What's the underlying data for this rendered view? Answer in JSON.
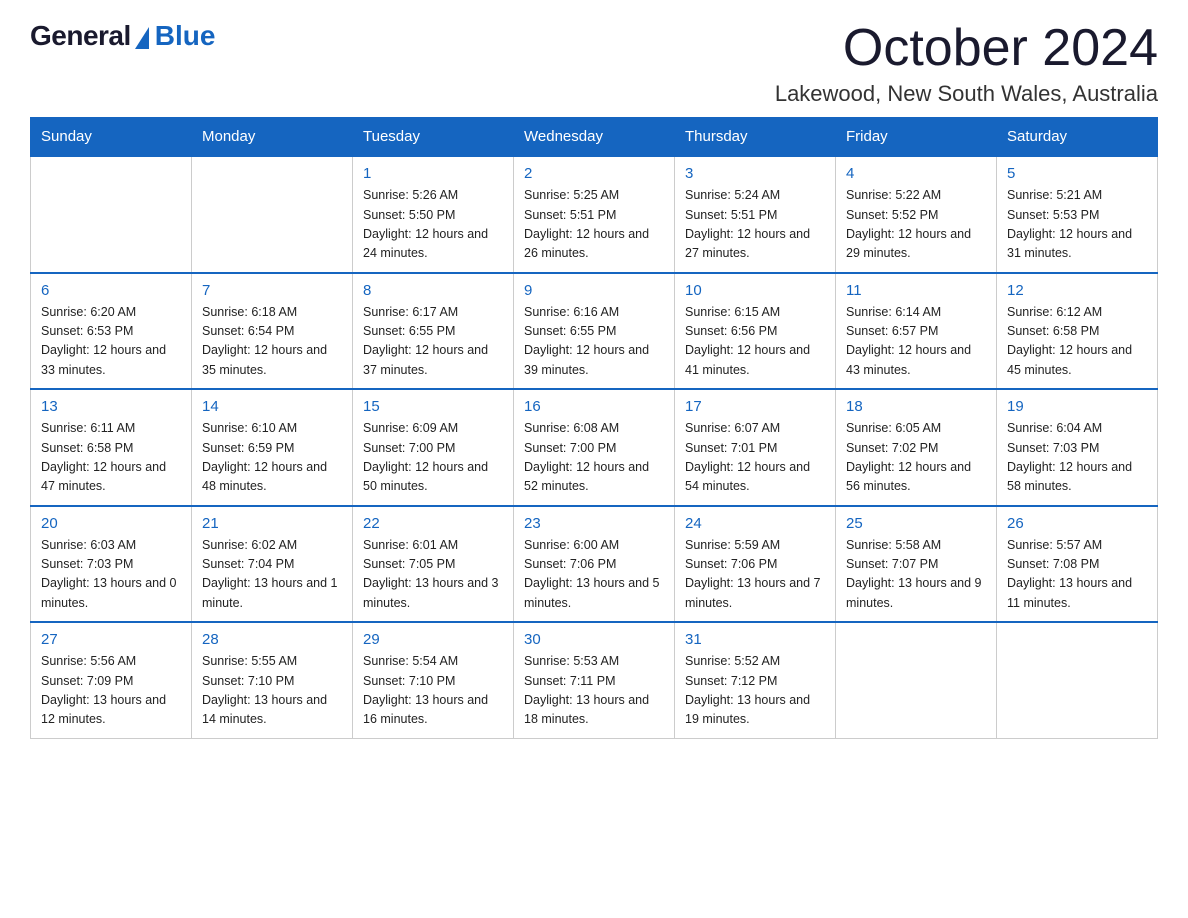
{
  "header": {
    "logo_general": "General",
    "logo_blue": "Blue",
    "month_title": "October 2024",
    "location": "Lakewood, New South Wales, Australia"
  },
  "days_of_week": [
    "Sunday",
    "Monday",
    "Tuesday",
    "Wednesday",
    "Thursday",
    "Friday",
    "Saturday"
  ],
  "weeks": [
    [
      {
        "day": "",
        "info": ""
      },
      {
        "day": "",
        "info": ""
      },
      {
        "day": "1",
        "info": "Sunrise: 5:26 AM\nSunset: 5:50 PM\nDaylight: 12 hours\nand 24 minutes."
      },
      {
        "day": "2",
        "info": "Sunrise: 5:25 AM\nSunset: 5:51 PM\nDaylight: 12 hours\nand 26 minutes."
      },
      {
        "day": "3",
        "info": "Sunrise: 5:24 AM\nSunset: 5:51 PM\nDaylight: 12 hours\nand 27 minutes."
      },
      {
        "day": "4",
        "info": "Sunrise: 5:22 AM\nSunset: 5:52 PM\nDaylight: 12 hours\nand 29 minutes."
      },
      {
        "day": "5",
        "info": "Sunrise: 5:21 AM\nSunset: 5:53 PM\nDaylight: 12 hours\nand 31 minutes."
      }
    ],
    [
      {
        "day": "6",
        "info": "Sunrise: 6:20 AM\nSunset: 6:53 PM\nDaylight: 12 hours\nand 33 minutes."
      },
      {
        "day": "7",
        "info": "Sunrise: 6:18 AM\nSunset: 6:54 PM\nDaylight: 12 hours\nand 35 minutes."
      },
      {
        "day": "8",
        "info": "Sunrise: 6:17 AM\nSunset: 6:55 PM\nDaylight: 12 hours\nand 37 minutes."
      },
      {
        "day": "9",
        "info": "Sunrise: 6:16 AM\nSunset: 6:55 PM\nDaylight: 12 hours\nand 39 minutes."
      },
      {
        "day": "10",
        "info": "Sunrise: 6:15 AM\nSunset: 6:56 PM\nDaylight: 12 hours\nand 41 minutes."
      },
      {
        "day": "11",
        "info": "Sunrise: 6:14 AM\nSunset: 6:57 PM\nDaylight: 12 hours\nand 43 minutes."
      },
      {
        "day": "12",
        "info": "Sunrise: 6:12 AM\nSunset: 6:58 PM\nDaylight: 12 hours\nand 45 minutes."
      }
    ],
    [
      {
        "day": "13",
        "info": "Sunrise: 6:11 AM\nSunset: 6:58 PM\nDaylight: 12 hours\nand 47 minutes."
      },
      {
        "day": "14",
        "info": "Sunrise: 6:10 AM\nSunset: 6:59 PM\nDaylight: 12 hours\nand 48 minutes."
      },
      {
        "day": "15",
        "info": "Sunrise: 6:09 AM\nSunset: 7:00 PM\nDaylight: 12 hours\nand 50 minutes."
      },
      {
        "day": "16",
        "info": "Sunrise: 6:08 AM\nSunset: 7:00 PM\nDaylight: 12 hours\nand 52 minutes."
      },
      {
        "day": "17",
        "info": "Sunrise: 6:07 AM\nSunset: 7:01 PM\nDaylight: 12 hours\nand 54 minutes."
      },
      {
        "day": "18",
        "info": "Sunrise: 6:05 AM\nSunset: 7:02 PM\nDaylight: 12 hours\nand 56 minutes."
      },
      {
        "day": "19",
        "info": "Sunrise: 6:04 AM\nSunset: 7:03 PM\nDaylight: 12 hours\nand 58 minutes."
      }
    ],
    [
      {
        "day": "20",
        "info": "Sunrise: 6:03 AM\nSunset: 7:03 PM\nDaylight: 13 hours\nand 0 minutes."
      },
      {
        "day": "21",
        "info": "Sunrise: 6:02 AM\nSunset: 7:04 PM\nDaylight: 13 hours\nand 1 minute."
      },
      {
        "day": "22",
        "info": "Sunrise: 6:01 AM\nSunset: 7:05 PM\nDaylight: 13 hours\nand 3 minutes."
      },
      {
        "day": "23",
        "info": "Sunrise: 6:00 AM\nSunset: 7:06 PM\nDaylight: 13 hours\nand 5 minutes."
      },
      {
        "day": "24",
        "info": "Sunrise: 5:59 AM\nSunset: 7:06 PM\nDaylight: 13 hours\nand 7 minutes."
      },
      {
        "day": "25",
        "info": "Sunrise: 5:58 AM\nSunset: 7:07 PM\nDaylight: 13 hours\nand 9 minutes."
      },
      {
        "day": "26",
        "info": "Sunrise: 5:57 AM\nSunset: 7:08 PM\nDaylight: 13 hours\nand 11 minutes."
      }
    ],
    [
      {
        "day": "27",
        "info": "Sunrise: 5:56 AM\nSunset: 7:09 PM\nDaylight: 13 hours\nand 12 minutes."
      },
      {
        "day": "28",
        "info": "Sunrise: 5:55 AM\nSunset: 7:10 PM\nDaylight: 13 hours\nand 14 minutes."
      },
      {
        "day": "29",
        "info": "Sunrise: 5:54 AM\nSunset: 7:10 PM\nDaylight: 13 hours\nand 16 minutes."
      },
      {
        "day": "30",
        "info": "Sunrise: 5:53 AM\nSunset: 7:11 PM\nDaylight: 13 hours\nand 18 minutes."
      },
      {
        "day": "31",
        "info": "Sunrise: 5:52 AM\nSunset: 7:12 PM\nDaylight: 13 hours\nand 19 minutes."
      },
      {
        "day": "",
        "info": ""
      },
      {
        "day": "",
        "info": ""
      }
    ]
  ]
}
